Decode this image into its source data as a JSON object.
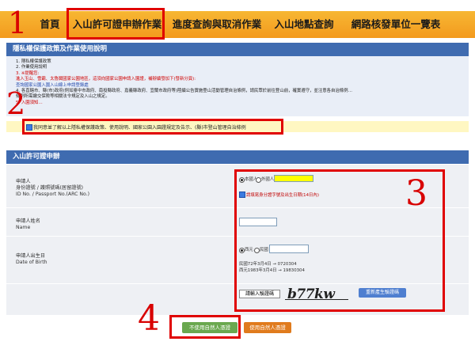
{
  "nav": {
    "items": [
      "首頁",
      "入山許可證申辦作業",
      "進度查詢與取消作業",
      "入山地點查詢",
      "網路核發單位一覽表"
    ]
  },
  "annotations": [
    "1",
    "2",
    "3",
    "4"
  ],
  "privacy": {
    "header": "隱私權保護政策及作業使用說明",
    "items": [
      {
        "text": "1. 隱私權保護政策",
        "red": false
      },
      {
        "text": "2. 作業使用說明",
        "red": false
      },
      {
        "text": "3. ※提醒您:",
        "red": true
      },
      {
        "text": "   進入玉山、雪霸、太魯閣國家公園地區，這須向國家公園申請入園證，補辦續發加下(發新分頁):",
        "red": true
      },
      {
        "text": "   查詢國家公園入園入山線上申請登錄處",
        "red": false
      },
      {
        "text": "4. 各直轄市、縣(市)政府(例如臺中市政府、南投縣政府、嘉義縣政府、宜蘭市政府等)陸續公告實施登山活動管理自治條例，請民眾於前往登山前，確實遵守，並注意各自治條例…",
        "red": false
      },
      {
        "text": "   條例所需繳交保險等相關法令規定及入山之規定。",
        "red": false
      },
      {
        "text": "5. 入園須知…",
        "red": true
      }
    ],
    "agree_text": "我同意並了解以上隱私權保護政策、使用說明、國家公園入園證規定及告示、(縣)市登山管理自治條例"
  },
  "form": {
    "header": "入山許可證申辦",
    "fields": [
      {
        "lines": [
          "申請人",
          "身份證號 / 護照號碼(居留證號)",
          "ID No. / Passport No.(ARC No.)"
        ]
      },
      {
        "lines": [
          "申請人姓名",
          "Name"
        ]
      },
      {
        "lines": [
          "申請人出生日",
          "Date of Birth"
        ]
      }
    ],
    "nationality": {
      "option1": "本國人",
      "option2": "外國人"
    },
    "id_note": "請填寫身分證字號及出生日期(14日內)",
    "birth": {
      "option1": "西元",
      "option2": "民國"
    },
    "birth_examples": [
      "民國72年3月4日 → 0720304",
      "西元1983年3月4日 → 19830304"
    ],
    "captcha_input_placeholder": "請輸入驗證碼",
    "captcha_text": "b77kw",
    "captcha_refresh": "重新產生驗證碼"
  },
  "buttons": {
    "no_natural_person": "不使用自然人憑證",
    "use_natural_person": "使用自然人憑證"
  },
  "colors": {
    "nav": "#f39a1e",
    "header": "#3f6bb0",
    "annotation": "#d80000",
    "green_button": "#6aa84f",
    "orange_button": "#e07b1d"
  }
}
